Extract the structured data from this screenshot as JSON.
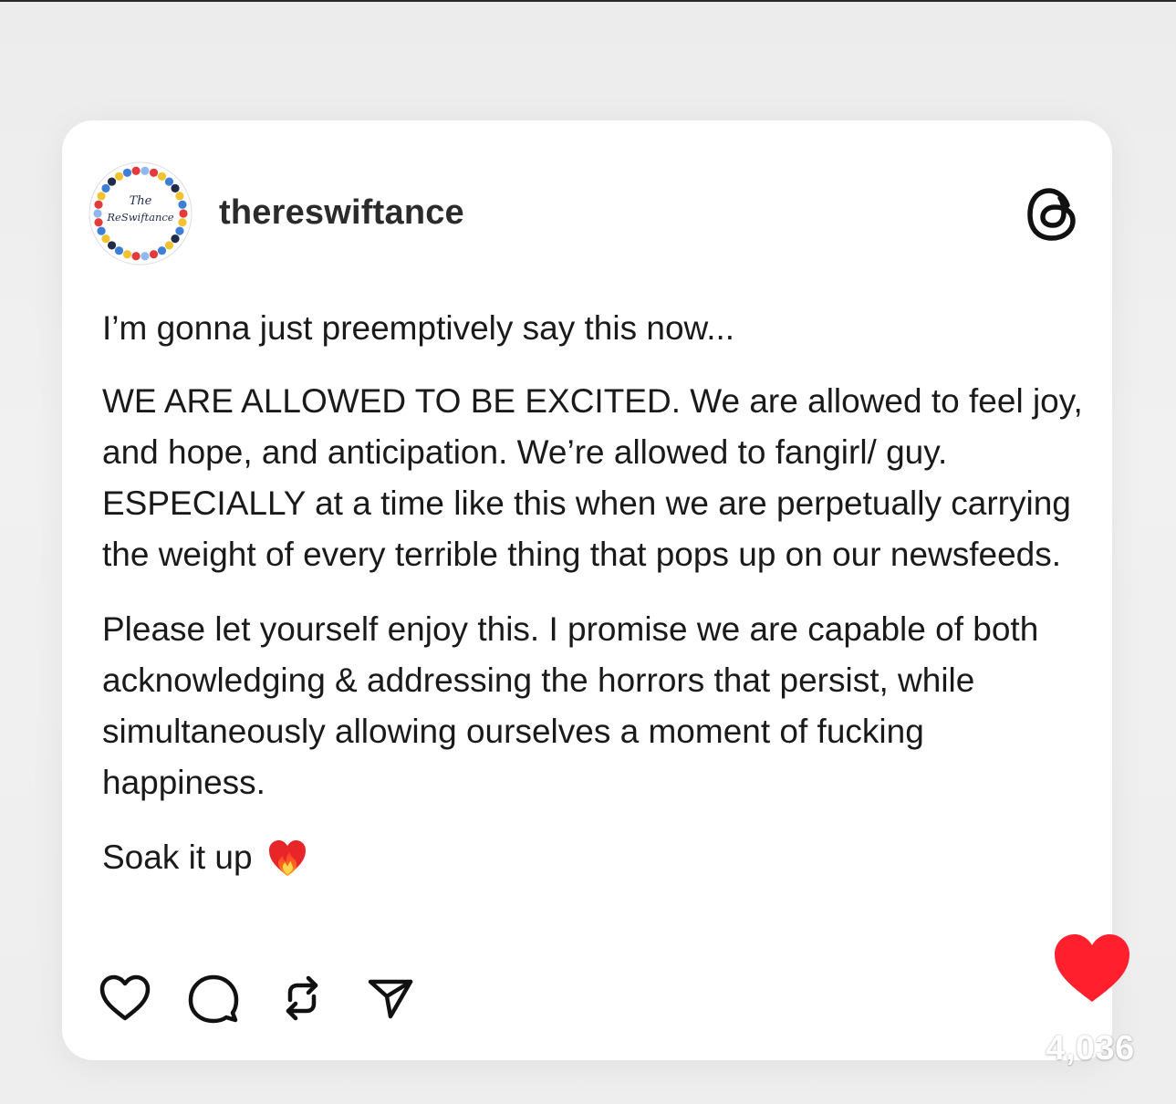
{
  "post": {
    "username": "thereswiftance",
    "avatar": {
      "line1": "The",
      "line2": "ReSwiftance",
      "icon": "swiftance-logo"
    },
    "app_icon": "threads-logo-icon",
    "paragraphs": [
      "I’m gonna just preemptively say this now...",
      "WE ARE ALLOWED TO BE EXCITED. We are allowed to feel joy, and hope, and anticipation. We’re allowed to fangirl/ guy. ESPECIALLY at a time like this when we are perpetually carrying the weight of every terrible thing that pops up on our newsfeeds.",
      "Please let yourself enjoy this. I promise we are capable of both acknowledging & addressing the horrors that persist, while simultaneously allowing ourselves a moment of fucking happiness."
    ],
    "closing": "Soak it up",
    "closing_emoji": "heart-on-fire-icon",
    "actions": [
      "heart-icon",
      "comment-icon",
      "repost-icon",
      "share-icon"
    ]
  },
  "overlay": {
    "like_icon": "red-heart-icon",
    "like_count": "4,036",
    "like_color": "#ff1f2d"
  }
}
